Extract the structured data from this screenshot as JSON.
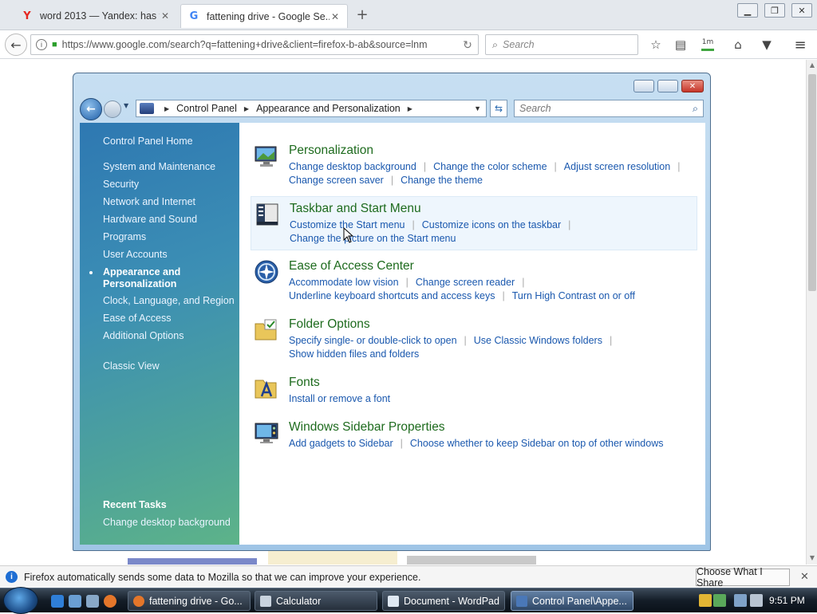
{
  "browser": {
    "tabs": [
      {
        "favicon": "Y",
        "title": "word 2013 — Yandex: has f...",
        "active": false
      },
      {
        "favicon": "G",
        "title": "fattening drive - Google Se...",
        "active": true
      }
    ],
    "url": "https://www.google.com/search?q=fattening+drive&client=firefox-b-ab&source=lnm",
    "search_placeholder": "Search",
    "toolbar_icons": [
      "star-icon",
      "reader-icon",
      "download-icon",
      "home-icon",
      "pocket-icon",
      "menu-icon"
    ],
    "download_badge": "1m"
  },
  "explorer": {
    "breadcrumb": [
      "Control Panel",
      "Appearance and Personalization"
    ],
    "search_placeholder": "Search"
  },
  "sidebar": {
    "home": "Control Panel Home",
    "items": [
      "System and Maintenance",
      "Security",
      "Network and Internet",
      "Hardware and Sound",
      "Programs",
      "User Accounts"
    ],
    "selected_line1": "Appearance and",
    "selected_line2": "Personalization",
    "items_after": [
      "Clock, Language, and Region",
      "Ease of Access",
      "Additional Options"
    ],
    "classic_view": "Classic View",
    "recent_tasks_heading": "Recent Tasks",
    "recent_task": "Change desktop background"
  },
  "categories": [
    {
      "title": "Personalization",
      "icon": "personalization-icon",
      "links": [
        "Change desktop background",
        "Change the color scheme",
        "Adjust screen resolution",
        "Change screen saver",
        "Change the theme"
      ]
    },
    {
      "title": "Taskbar and Start Menu",
      "icon": "taskbar-icon",
      "links": [
        "Customize the Start menu",
        "Customize icons on the taskbar",
        "Change the picture on the Start menu"
      ]
    },
    {
      "title": "Ease of Access Center",
      "icon": "ease-of-access-icon",
      "links": [
        "Accommodate low vision",
        "Change screen reader",
        "Underline keyboard shortcuts and access keys",
        "Turn High Contrast on or off"
      ]
    },
    {
      "title": "Folder Options",
      "icon": "folder-options-icon",
      "links": [
        "Specify single- or double-click to open",
        "Use Classic Windows folders",
        "Show hidden files and folders"
      ]
    },
    {
      "title": "Fonts",
      "icon": "fonts-icon",
      "links": [
        "Install or remove a font"
      ]
    },
    {
      "title": "Windows Sidebar Properties",
      "icon": "sidebar-properties-icon",
      "links": [
        "Add gadgets to Sidebar",
        "Choose whether to keep Sidebar on top of other windows"
      ]
    }
  ],
  "notification": {
    "text": "Firefox automatically sends some data to Mozilla so that we can improve your experience.",
    "button": "Choose What I Share"
  },
  "taskbar": {
    "tasks": [
      {
        "label": "fattening drive - Go...",
        "active": false
      },
      {
        "label": "Calculator",
        "active": false
      },
      {
        "label": "Document - WordPad",
        "active": false
      },
      {
        "label": "Control Panel\\Appe...",
        "active": true
      }
    ],
    "time": "9:51 PM"
  },
  "colors": {
    "link": "#1a58ae",
    "category_title": "#1e6b1e",
    "sidebar_top": "#2e78b2",
    "sidebar_bottom": "#5db389"
  }
}
